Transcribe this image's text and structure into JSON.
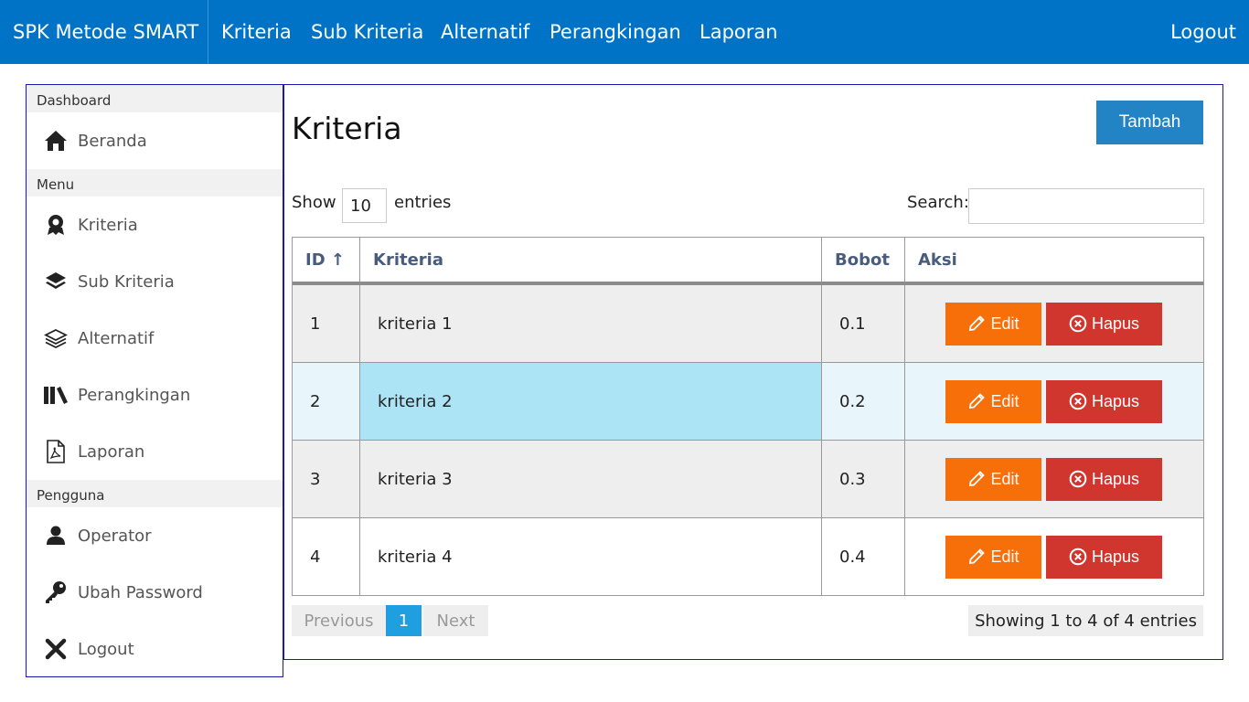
{
  "navbar": {
    "brand": "SPK Metode SMART",
    "links": [
      "Kriteria",
      "Sub Kriteria",
      "Alternatif",
      "Perangkingan",
      "Laporan"
    ],
    "logout": "Logout"
  },
  "sidebar": {
    "sections": [
      {
        "header": "Dashboard",
        "items": [
          {
            "label": "Beranda",
            "icon": "home-icon"
          }
        ]
      },
      {
        "header": "Menu",
        "items": [
          {
            "label": "Kriteria",
            "icon": "award-icon"
          },
          {
            "label": "Sub Kriteria",
            "icon": "layers-solid-icon"
          },
          {
            "label": "Alternatif",
            "icon": "layers-outline-icon"
          },
          {
            "label": "Perangkingan",
            "icon": "books-icon"
          },
          {
            "label": "Laporan",
            "icon": "pdf-file-icon"
          }
        ]
      },
      {
        "header": "Pengguna",
        "items": [
          {
            "label": "Operator",
            "icon": "user-icon"
          },
          {
            "label": "Ubah Password",
            "icon": "key-icon"
          },
          {
            "label": "Logout",
            "icon": "x-icon"
          }
        ]
      }
    ]
  },
  "main": {
    "title": "Kriteria",
    "add_button": "Tambah",
    "show_label": "Show",
    "entries_value": "10",
    "entries_label": "entries",
    "search_label": "Search:",
    "search_value": "",
    "table": {
      "headers": [
        "ID ↑",
        "Kriteria",
        "Bobot",
        "Aksi"
      ],
      "rows": [
        {
          "id": "1",
          "kriteria": "kriteria 1",
          "bobot": "0.1"
        },
        {
          "id": "2",
          "kriteria": "kriteria 2",
          "bobot": "0.2"
        },
        {
          "id": "3",
          "kriteria": "kriteria 3",
          "bobot": "0.3"
        },
        {
          "id": "4",
          "kriteria": "kriteria 4",
          "bobot": "0.4"
        }
      ],
      "edit_label": "Edit",
      "delete_label": "Hapus"
    },
    "pagination": {
      "previous": "Previous",
      "page": "1",
      "next": "Next"
    },
    "info": "Showing 1 to 4 of 4 entries"
  },
  "colors": {
    "navbar": "#0073c6",
    "edit": "#f66f09",
    "delete": "#d0362e",
    "add": "#2284c4",
    "row_odd": "#eeeeee",
    "row_hover": "#e8f6fb",
    "cell_highlight": "#ace4f6"
  }
}
